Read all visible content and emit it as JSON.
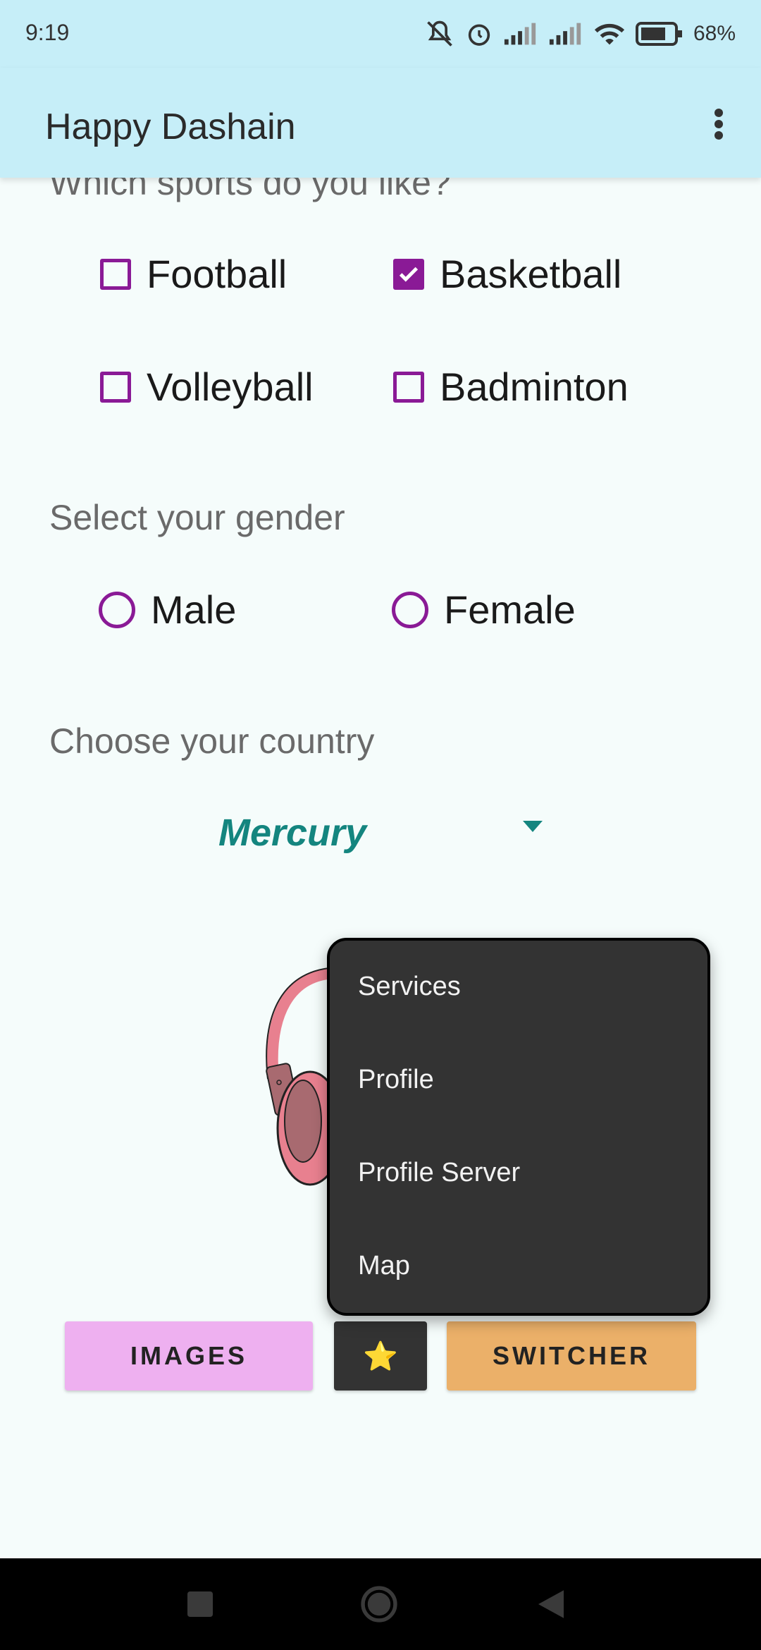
{
  "status_bar": {
    "time": "9:19",
    "battery_percent": "68%",
    "icons": [
      "mute-icon",
      "alarm-icon",
      "signal-icon",
      "signal-icon",
      "wifi-icon",
      "battery-icon"
    ]
  },
  "app_bar": {
    "title": "Happy Dashain",
    "overflow_icon": "more-vert-icon"
  },
  "sports": {
    "heading": "Which sports do you like?",
    "options": [
      {
        "label": "Football",
        "checked": false
      },
      {
        "label": "Basketball",
        "checked": true
      },
      {
        "label": "Volleyball",
        "checked": false
      },
      {
        "label": "Badminton",
        "checked": false
      }
    ]
  },
  "gender": {
    "heading": "Select your gender",
    "options": [
      {
        "label": "Male",
        "selected": false
      },
      {
        "label": "Female",
        "selected": false
      }
    ]
  },
  "country": {
    "heading": "Choose your country",
    "selected": "Mercury"
  },
  "buttons": {
    "images": "IMAGES",
    "star": "⭐",
    "switcher": "SWITCHER"
  },
  "menu": {
    "items": [
      "Services",
      "Profile",
      "Profile Server",
      "Map"
    ]
  },
  "colors": {
    "app_bar": "#c6eef8",
    "accent_purple": "#8a1a96",
    "spinner_teal": "#14857f",
    "images_button": "#eeb0f0",
    "switcher_button": "#ebb069",
    "menu_background": "#333333"
  }
}
